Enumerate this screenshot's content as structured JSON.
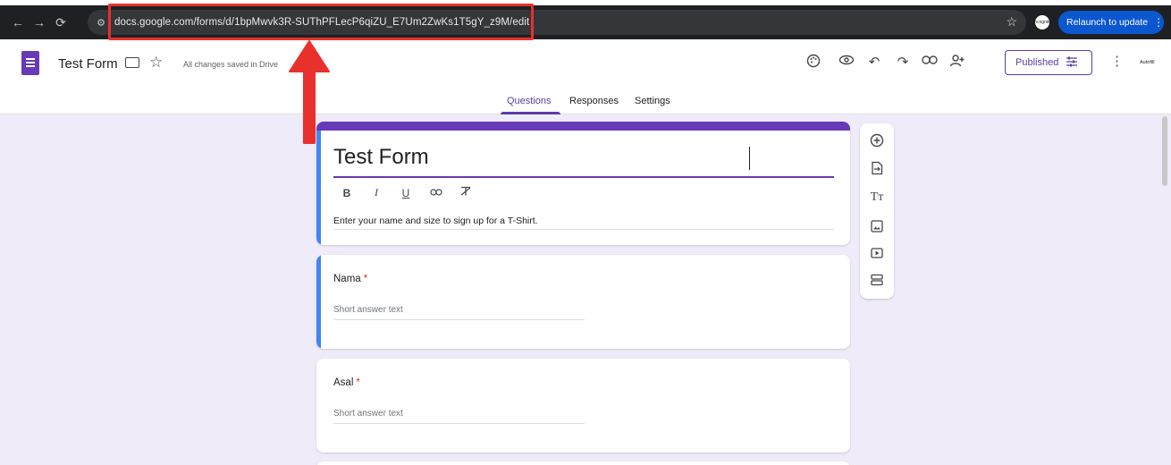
{
  "browser": {
    "url": "docs.google.com/forms/d/1bpMwvk3R-SUThPFLecP6qiZU_E7Um2ZwKs1T5gY_z9M/edit",
    "relaunch_label": "Relaunch to update",
    "profile_label": "Incognito"
  },
  "header": {
    "doc_title": "Test Form",
    "saved_status": "All changes saved in Drive",
    "published_label": "Published",
    "autofill_label": "Autofill"
  },
  "tabs": [
    {
      "label": "Questions",
      "active": true
    },
    {
      "label": "Responses",
      "active": false
    },
    {
      "label": "Settings",
      "active": false
    }
  ],
  "form": {
    "title": "Test Form",
    "description": "Enter your name and size to sign up for a T-Shirt.",
    "questions": [
      {
        "label": "Nama",
        "required_mark": "*",
        "placeholder": "Short answer text"
      },
      {
        "label": "Asal",
        "required_mark": "*",
        "placeholder": "Short answer text"
      }
    ]
  },
  "colors": {
    "accent": "#673ab7",
    "highlight_red": "#e8302c",
    "relaunch_blue": "#0b57d0",
    "background": "#f0ebf8"
  },
  "icons": {
    "forms_logo": "google-forms-icon",
    "palette": "palette-icon",
    "preview": "eye-icon",
    "undo": "undo-icon",
    "redo": "redo-icon",
    "link": "link-icon",
    "add_collaborator": "person-add-icon",
    "side_tools": [
      "add-question-icon",
      "import-questions-icon",
      "add-title-icon",
      "add-image-icon",
      "add-video-icon",
      "add-section-icon"
    ]
  }
}
